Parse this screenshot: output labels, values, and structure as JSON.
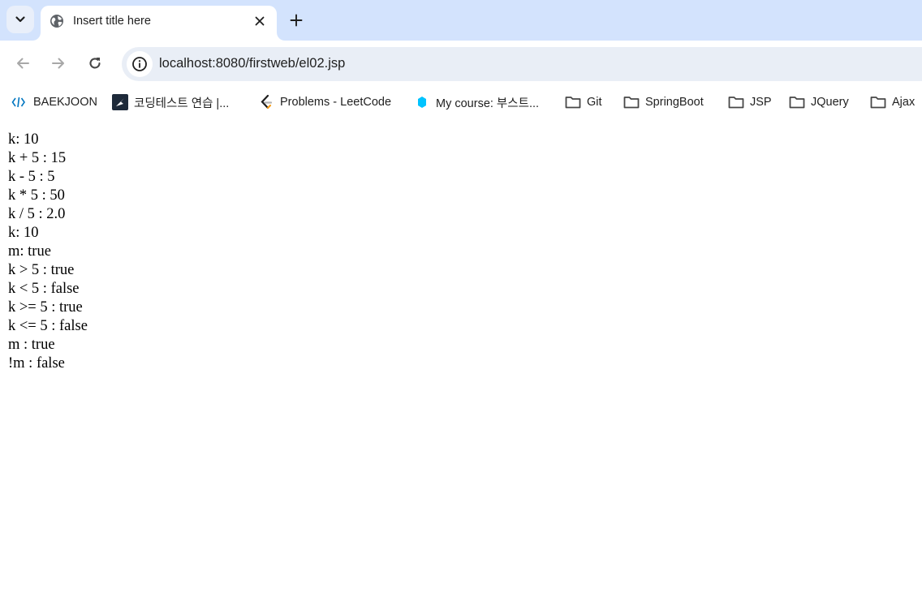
{
  "browser": {
    "tab": {
      "title": "Insert title here"
    },
    "address_bar": {
      "url": "localhost:8080/firstweb/el02.jsp"
    },
    "bookmarks": [
      {
        "label": "BAEKJOON",
        "icon": "baekjoon-icon"
      },
      {
        "label": "코딩테스트 연습 |...",
        "icon": "programmers-icon"
      },
      {
        "label": "Problems - LeetCode",
        "icon": "leetcode-icon"
      },
      {
        "label": "My course: 부스트...",
        "icon": "boostcourse-icon"
      },
      {
        "label": "Git",
        "icon": "folder-icon"
      },
      {
        "label": "SpringBoot",
        "icon": "folder-icon"
      },
      {
        "label": "JSP",
        "icon": "folder-icon"
      },
      {
        "label": "JQuery",
        "icon": "folder-icon"
      },
      {
        "label": "Ajax",
        "icon": "folder-icon"
      }
    ]
  },
  "page": {
    "lines": [
      "k: 10",
      "k + 5 : 15",
      "k - 5 : 5",
      "k * 5 : 50",
      "k / 5 : 2.0",
      "k: 10",
      "m: true",
      "k > 5 : true",
      "k < 5 : false",
      "k >= 5 : true",
      "k <= 5 : false",
      "m : true",
      "!m : false"
    ]
  },
  "colors": {
    "tabstrip": "#d3e3fd",
    "omnibox": "#e9eef6",
    "icon_gray": "#474747",
    "icon_disabled": "#a8a8a8"
  }
}
